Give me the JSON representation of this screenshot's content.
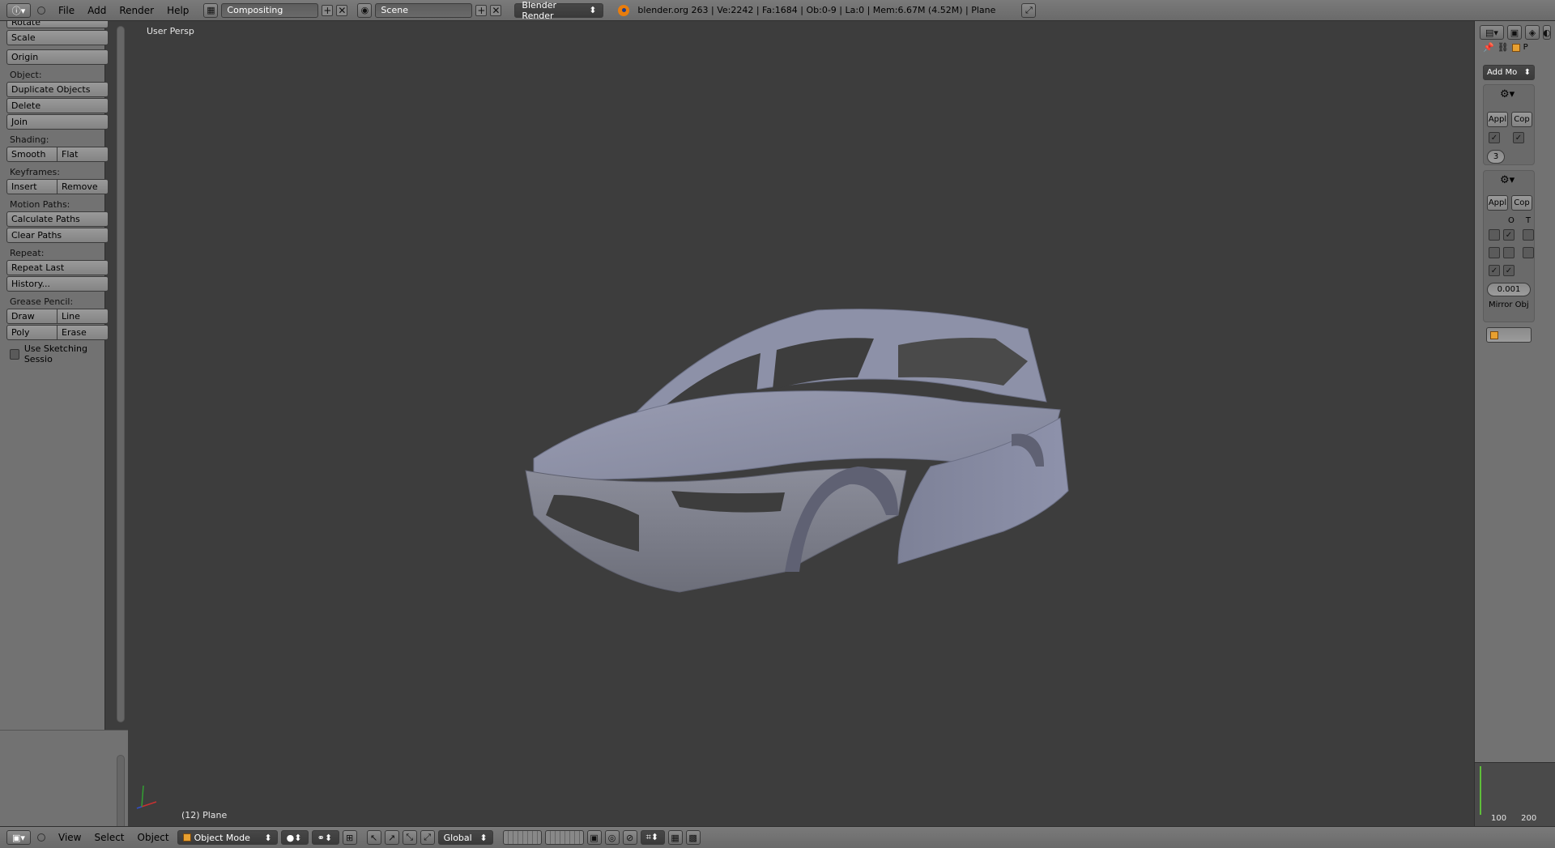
{
  "top_header": {
    "menus": [
      "File",
      "Add",
      "Render",
      "Help"
    ],
    "screen_layout": "Compositing",
    "scene": "Scene",
    "render_engine": "Blender Render",
    "stats": "blender.org 263 | Ve:2242 | Fa:1684 | Ob:0-9 | La:0 | Mem:6.67M (4.52M) | Plane"
  },
  "tool_shelf": {
    "top_buttons": [
      "Rotate",
      "Scale",
      "Origin"
    ],
    "object_label": "Object:",
    "object_buttons": [
      "Duplicate Objects",
      "Delete",
      "Join"
    ],
    "shading_label": "Shading:",
    "shading_buttons": [
      "Smooth",
      "Flat"
    ],
    "keyframes_label": "Keyframes:",
    "keyframes_buttons": [
      "Insert",
      "Remove"
    ],
    "motion_paths_label": "Motion Paths:",
    "motion_paths_buttons": [
      "Calculate Paths",
      "Clear Paths"
    ],
    "repeat_label": "Repeat:",
    "repeat_buttons": [
      "Repeat Last",
      "History..."
    ],
    "grease_pencil_label": "Grease Pencil:",
    "grease_row1": [
      "Draw",
      "Line"
    ],
    "grease_row2": [
      "Poly",
      "Erase"
    ],
    "sketching_checkbox": "Use Sketching Sessio"
  },
  "viewport": {
    "view_label": "User Persp",
    "object_label": "(12) Plane"
  },
  "properties": {
    "tab_label": "P",
    "add_modifier": "Add Mo",
    "apply_1": "Appl",
    "copy_1": "Cop",
    "levels": "3",
    "apply_2": "Appl",
    "copy_2": "Cop",
    "col_o": "O",
    "col_t": "T",
    "merge_limit": "0.001",
    "mirror_object": "Mirror Obj"
  },
  "timeline": {
    "labels": [
      "100",
      "200"
    ]
  },
  "bottom_header": {
    "menus": [
      "View",
      "Select",
      "Object"
    ],
    "mode": "Object Mode",
    "orientation": "Global"
  },
  "colors": {
    "viewport_bg": "#3d3d3d",
    "panel_bg": "#727272",
    "header_bg": "#707070",
    "car": "#8a8ea6"
  }
}
